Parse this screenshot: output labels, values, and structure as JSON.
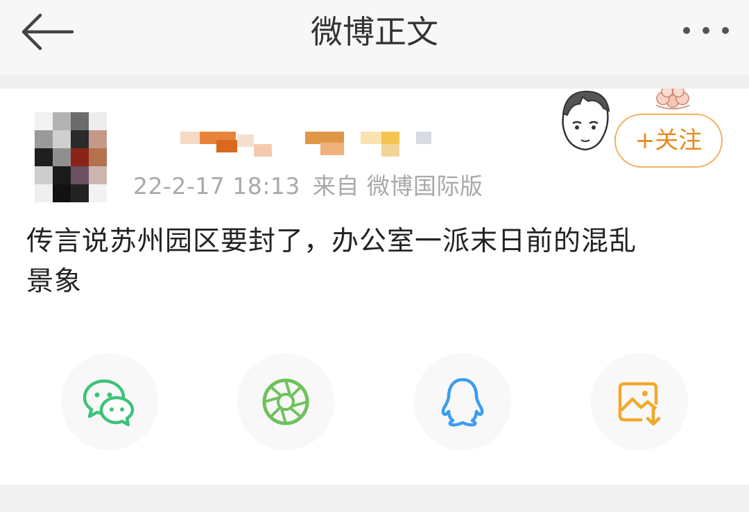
{
  "header": {
    "title": "微博正文",
    "back_icon": "arrow-left-icon",
    "more_icon": "more-dots-icon"
  },
  "post": {
    "timestamp": "22-2-17 18:13",
    "source": "来自 微博国际版",
    "follow_label": "+关注",
    "text_line1": "传言说苏州园区要封了，办公室一派末日前的混乱",
    "text_line2": "景象"
  },
  "share": [
    {
      "name": "wechat",
      "icon": "wechat-icon",
      "color": "#3ec27a"
    },
    {
      "name": "moments",
      "icon": "wechat-moments-icon",
      "color": "#6dc25a"
    },
    {
      "name": "qq",
      "icon": "qq-icon",
      "color": "#3b9cf0"
    },
    {
      "name": "save-image",
      "icon": "save-image-icon",
      "color": "#f0a92a"
    }
  ],
  "colors": {
    "accent": "#e8891f",
    "follow_border": "#f2b061",
    "meta_text": "#a9a9a9"
  }
}
